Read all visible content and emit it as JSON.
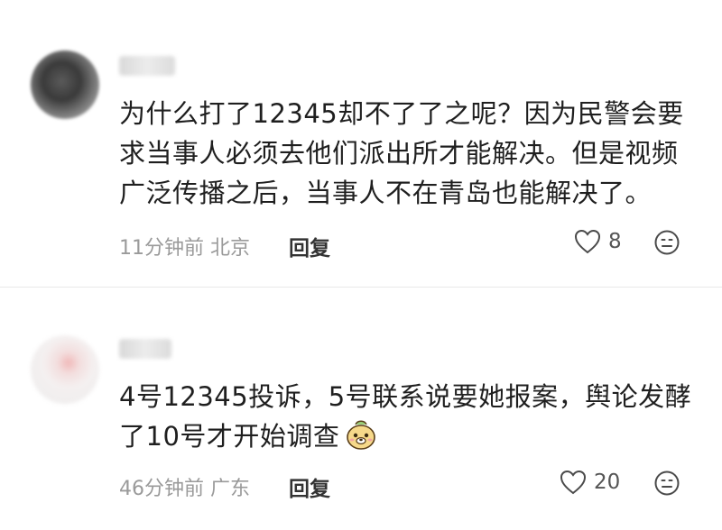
{
  "comments": [
    {
      "username": "An颐",
      "text_lines": [
        "为什么打了12345却不了了之呢？因为民警会要",
        "求当事人必须去他们派出所才能解决。但是视频",
        "广泛传播之后，当事人不在青岛也能解决了。"
      ],
      "meta": "11分钟前 北京",
      "reply_label": "回复",
      "likes": "8"
    },
    {
      "username": "小洛",
      "text_lines": [
        "4号12345投诉，5号联系说要她报案，舆论发酵",
        "了10号才开始调查"
      ],
      "sticker": "dog-face-sticker",
      "meta": "46分钟前 广东",
      "reply_label": "回复",
      "likes": "20"
    }
  ],
  "icons": {
    "like": "heart-outline-icon",
    "react": "smiley-face-icon"
  },
  "colors": {
    "text": "#1f1f1f",
    "meta": "#9a9a9a",
    "divider": "#e8e8e8"
  }
}
